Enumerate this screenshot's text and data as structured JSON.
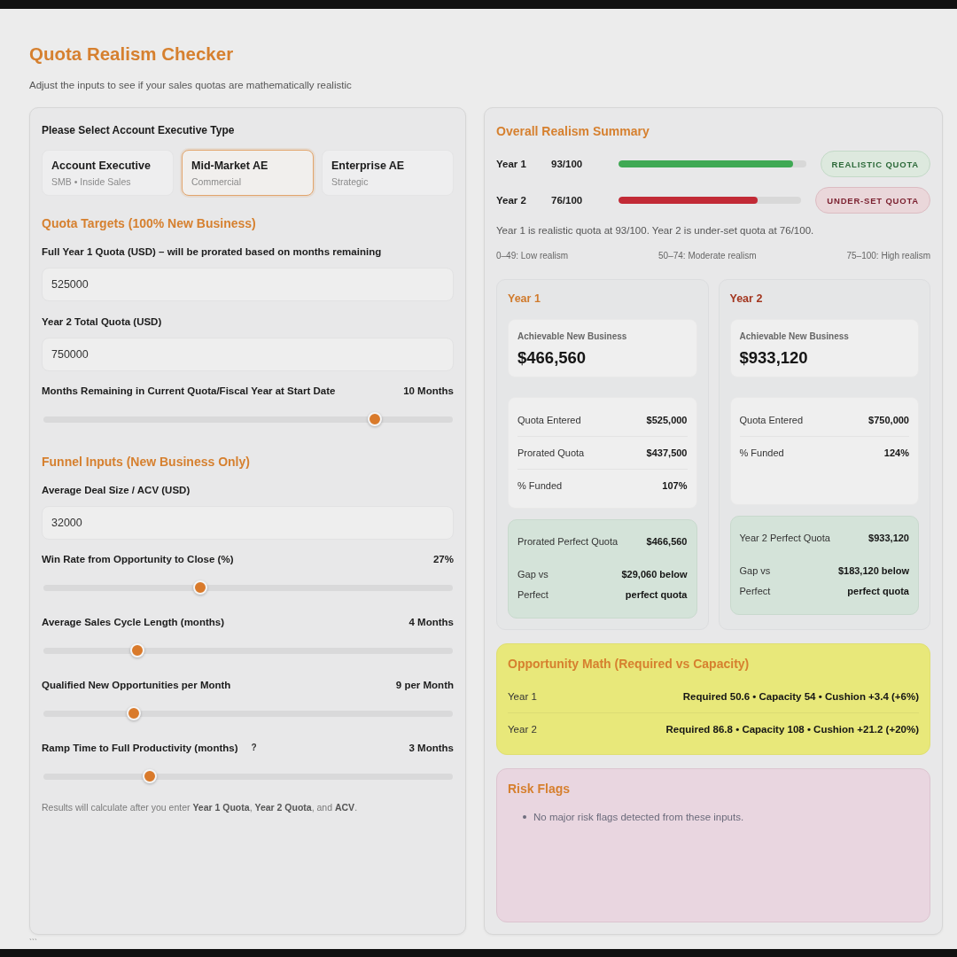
{
  "header": {
    "title": "Quota Realism Checker",
    "subtitle": "Adjust the inputs to see if your sales quotas are mathematically realistic"
  },
  "inputs_panel": {
    "type_prompt": "Please Select Account Executive Type",
    "ae_types": [
      {
        "title": "Account Executive",
        "subtitle": "SMB • Inside Sales",
        "selected": false
      },
      {
        "title": "Mid-Market AE",
        "subtitle": "Commercial",
        "selected": true
      },
      {
        "title": "Enterprise AE",
        "subtitle": "Strategic",
        "selected": false
      }
    ],
    "sections": [
      {
        "heading": "Quota Targets (100% New Business)",
        "fields": [
          {
            "kind": "input",
            "label": "Full Year 1 Quota (USD) – will be prorated based on months remaining",
            "value": "525000"
          },
          {
            "kind": "input",
            "label": "Year 2 Total Quota (USD)",
            "value": "750000"
          },
          {
            "kind": "slider",
            "label": "Months Remaining in Current Quota/Fiscal Year at Start Date",
            "reading": "10 Months",
            "level": 0.82
          }
        ]
      },
      {
        "heading": "Funnel Inputs (New Business Only)",
        "fields": [
          {
            "kind": "input",
            "label": "Average Deal Size / ACV (USD)",
            "value": "32000"
          },
          {
            "kind": "slider",
            "label": "Win Rate from Opportunity to Close (%)",
            "reading": "27%",
            "level": 0.38
          },
          {
            "kind": "slider",
            "label": "Average Sales Cycle Length (months)",
            "reading": "4 Months",
            "level": 0.22
          },
          {
            "kind": "slider",
            "label": "Qualified New Opportunities per Month",
            "reading": "9 per Month",
            "level": 0.21
          },
          {
            "kind": "slider",
            "label": "Ramp Time to Full Productivity (months)",
            "help": "?",
            "reading": "3 Months",
            "level": 0.25
          }
        ]
      }
    ],
    "note": "Results will calculate after you enter **Year 1 Quota**, **Year 2 Quota**, and **ACV**."
  },
  "summary_panel": {
    "heading": "Overall Realism Summary",
    "scores": [
      {
        "label": "Year 1",
        "score": "93/100",
        "level": 0.93,
        "color": "#3fa954",
        "badge": {
          "text": "REALISTIC QUOTA",
          "kind": "realistic"
        }
      },
      {
        "label": "Year 2",
        "score": "76/100",
        "level": 0.76,
        "color": "#c22a36",
        "badge": {
          "text": "UNDER-SET QUOTA",
          "kind": "under-set"
        }
      }
    ],
    "summary": "Year 1 is realistic quota at 93/100. Year 2 is under-set quota at 76/100.",
    "legend": [
      "0–49: Low realism",
      "50–74: Moderate realism",
      "75–100: High realism"
    ],
    "year_cards": [
      {
        "title": "Year 1",
        "color": "#d07a2c",
        "achievable": {
          "label": "Achievable New Business",
          "value": "$466,560"
        },
        "metrics": [
          {
            "label": "Quota Entered",
            "value": "$525,000"
          },
          {
            "label": "Prorated Quota",
            "value": "$437,500"
          },
          {
            "label": "% Funded",
            "value": "107%"
          }
        ],
        "perfect": [
          {
            "label": "Prorated Perfect Quota",
            "value": "$466,560"
          },
          {
            "label": "Gap vs Perfect",
            "value": "$29,060 below perfect quota"
          }
        ]
      },
      {
        "title": "Year 2",
        "color": "#a3361f",
        "achievable": {
          "label": "Achievable New Business",
          "value": "$933,120"
        },
        "metrics": [
          {
            "label": "Quota Entered",
            "value": "$750,000"
          },
          {
            "label": "% Funded",
            "value": "124%"
          }
        ],
        "perfect": [
          {
            "label": "Year 2 Perfect Quota",
            "value": "$933,120"
          },
          {
            "label": "Gap vs Perfect",
            "value": "$183,120 below perfect quota"
          }
        ]
      }
    ],
    "opportunity_math": {
      "heading": "Opportunity Math (Required vs Capacity)",
      "rows": [
        {
          "label": "Year 1",
          "value": "Required 50.6 • Capacity 54 • Cushion +3.4 (+6%)"
        },
        {
          "label": "Year 2",
          "value": "Required 86.8 • Capacity 108 • Cushion +21.2 (+20%)"
        }
      ]
    },
    "risk_flags": {
      "heading": "Risk Flags",
      "items": [
        "No major risk flags detected from these inputs."
      ]
    }
  },
  "footer_note": "```"
}
